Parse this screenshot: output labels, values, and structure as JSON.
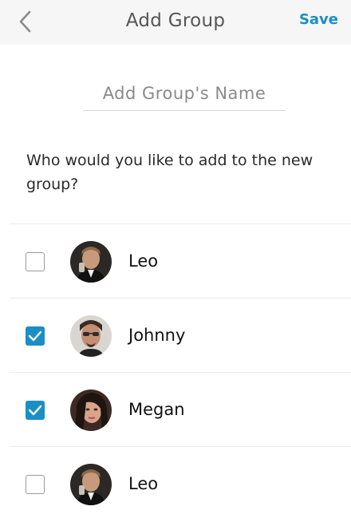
{
  "header": {
    "title": "Add Group",
    "save_label": "Save"
  },
  "group_name": {
    "value": "",
    "placeholder": "Add Group's Name"
  },
  "prompt": "Who would you like to add to the new group?",
  "contacts": [
    {
      "name": "Leo",
      "checked": false,
      "avatar_icon": "leo-avatar"
    },
    {
      "name": "Johnny",
      "checked": true,
      "avatar_icon": "johnny-avatar"
    },
    {
      "name": "Megan",
      "checked": true,
      "avatar_icon": "megan-avatar"
    },
    {
      "name": "Leo",
      "checked": false,
      "avatar_icon": "leo-avatar"
    }
  ],
  "colors": {
    "accent": "#1a8fc4",
    "header_bg": "#f6f6f6"
  }
}
